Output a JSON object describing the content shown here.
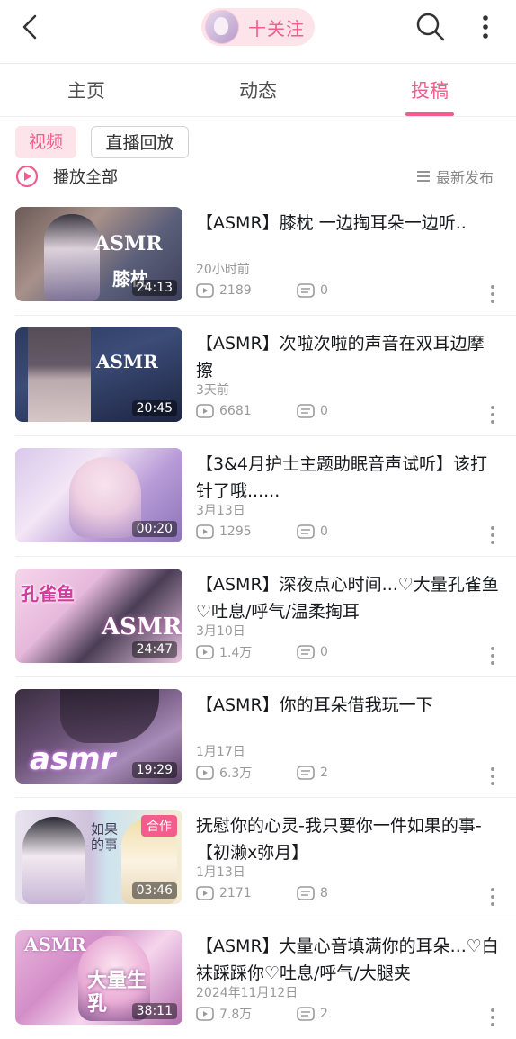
{
  "header": {
    "follow_label": "十关注"
  },
  "tabs": [
    {
      "label": "主页"
    },
    {
      "label": "动态"
    },
    {
      "label": "投稿"
    }
  ],
  "filters": {
    "video": "视频",
    "live_replay": "直播回放"
  },
  "play_all": "播放全部",
  "sort": "最新发布",
  "colors": {
    "accent": "#f25d8e",
    "accent_light": "#fde3ea",
    "muted": "#9a9a9a"
  },
  "videos": [
    {
      "title": "【ASMR】膝枕 一边掏耳朵一边听..",
      "date": "20小时前",
      "plays": "2189",
      "danmaku": "0",
      "duration": "24:13",
      "thumb_text": "ASMR",
      "thumb_text2": "膝枕"
    },
    {
      "title": "【ASMR】次啦次啦的声音在双耳边摩擦",
      "date": "3天前",
      "plays": "6681",
      "danmaku": "0",
      "duration": "20:45",
      "thumb_text": "ASMR"
    },
    {
      "title": "【3&4月护士主题助眠音声试听】该打针了哦......",
      "date": "3月13日",
      "plays": "1295",
      "danmaku": "0",
      "duration": "00:20"
    },
    {
      "title": "【ASMR】深夜点心时间...♡大量孔雀鱼♡吐息/呼气/温柔掏耳",
      "date": "3月10日",
      "plays": "1.4万",
      "danmaku": "0",
      "duration": "24:47",
      "thumb_text": "ASMR",
      "thumb_text2": "孔雀鱼"
    },
    {
      "title": "【ASMR】你的耳朵借我玩一下",
      "date": "1月17日",
      "plays": "6.3万",
      "danmaku": "2",
      "duration": "19:29",
      "thumb_text": "asmr"
    },
    {
      "title": "抚慰你的心灵-我只要你一件如果的事-【初濑x弥月】",
      "date": "1月13日",
      "plays": "2171",
      "danmaku": "8",
      "duration": "03:46",
      "badge": "合作",
      "thumb_text": "如果的事"
    },
    {
      "title": "【ASMR】大量心音填满你的耳朵...♡白袜踩踩你♡吐息/呼气/大腿夹",
      "date": "2024年11月12日",
      "plays": "7.8万",
      "danmaku": "2",
      "duration": "38:11",
      "thumb_text": "ASMR",
      "thumb_text2": "大量生乳"
    }
  ]
}
